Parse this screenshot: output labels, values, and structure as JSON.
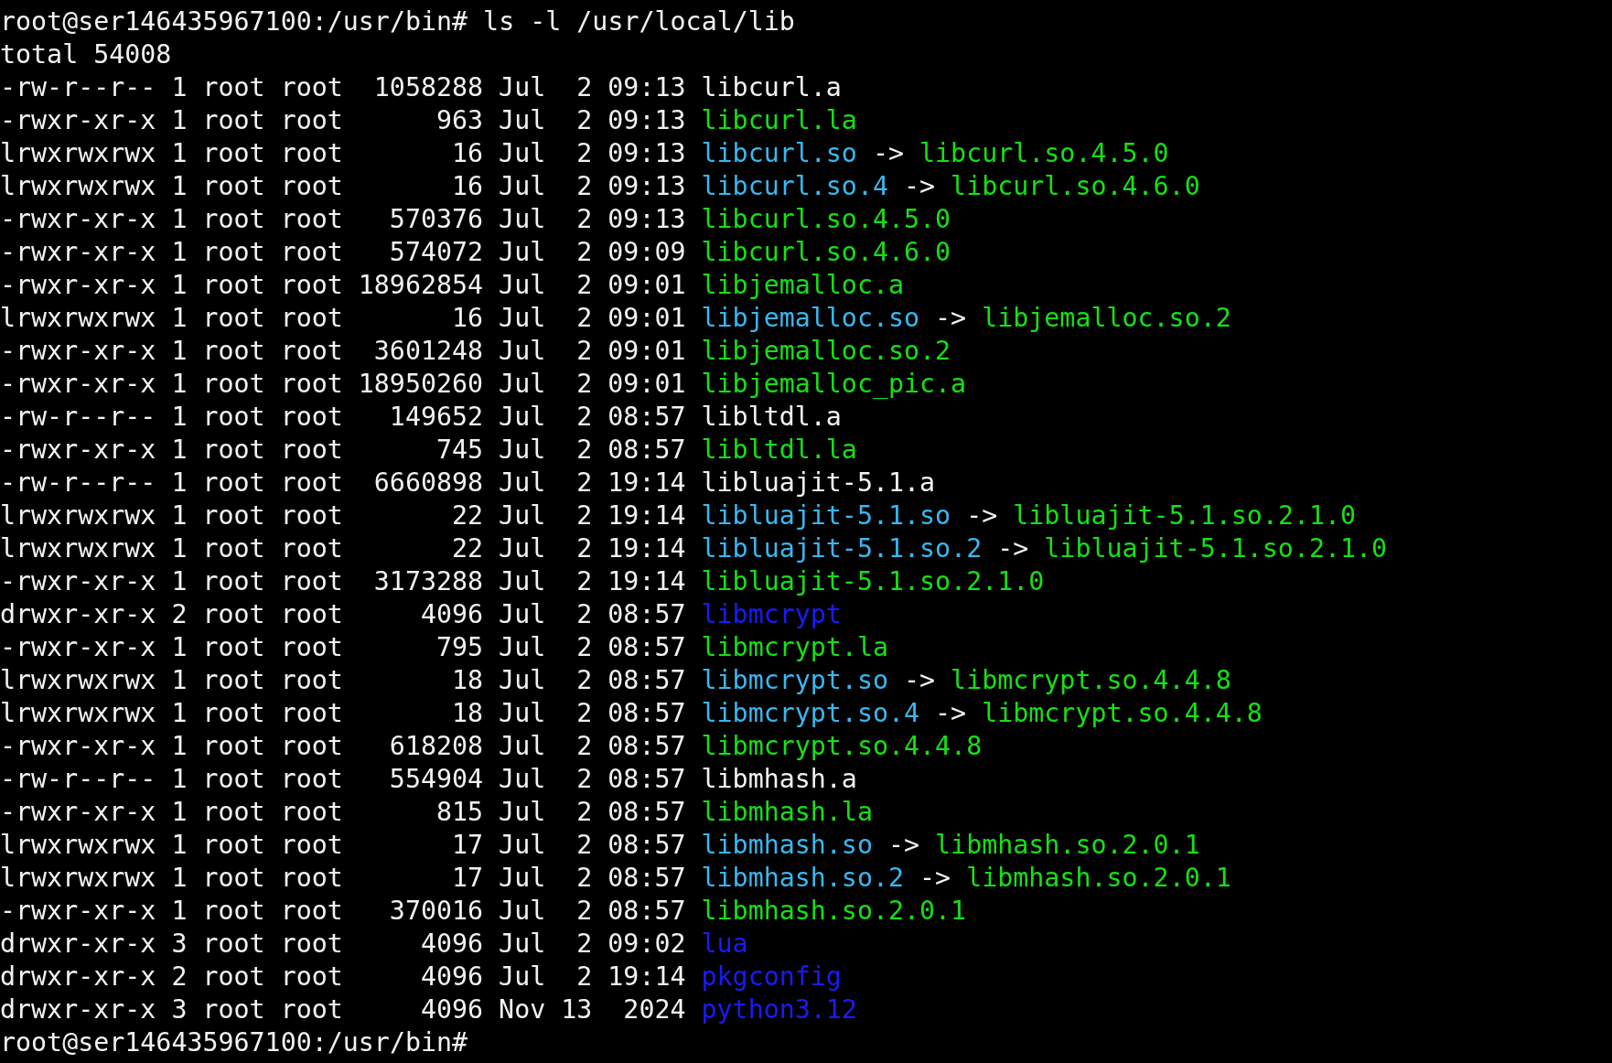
{
  "command_line": "root@ser146435967100:/usr/bin# ls -l /usr/local/lib",
  "total": "total 54008",
  "entries": [
    {
      "mode": "-rw-r--r--",
      "links": "1",
      "owner": "root",
      "group": "root",
      "size": "1058288",
      "month": "Jul",
      "day": "2",
      "time": "09:13",
      "name": "libcurl.a",
      "kind": "plain"
    },
    {
      "mode": "-rwxr-xr-x",
      "links": "1",
      "owner": "root",
      "group": "root",
      "size": "963",
      "month": "Jul",
      "day": "2",
      "time": "09:13",
      "name": "libcurl.la",
      "kind": "exec"
    },
    {
      "mode": "lrwxrwxrwx",
      "links": "1",
      "owner": "root",
      "group": "root",
      "size": "16",
      "month": "Jul",
      "day": "2",
      "time": "09:13",
      "name": "libcurl.so",
      "kind": "link",
      "arrow": "->",
      "target": {
        "name": "libcurl.so.4.5.0",
        "kind": "exec"
      }
    },
    {
      "mode": "lrwxrwxrwx",
      "links": "1",
      "owner": "root",
      "group": "root",
      "size": "16",
      "month": "Jul",
      "day": "2",
      "time": "09:13",
      "name": "libcurl.so.4",
      "kind": "link",
      "arrow": "->",
      "target": {
        "name": "libcurl.so.4.6.0",
        "kind": "exec"
      }
    },
    {
      "mode": "-rwxr-xr-x",
      "links": "1",
      "owner": "root",
      "group": "root",
      "size": "570376",
      "month": "Jul",
      "day": "2",
      "time": "09:13",
      "name": "libcurl.so.4.5.0",
      "kind": "exec"
    },
    {
      "mode": "-rwxr-xr-x",
      "links": "1",
      "owner": "root",
      "group": "root",
      "size": "574072",
      "month": "Jul",
      "day": "2",
      "time": "09:09",
      "name": "libcurl.so.4.6.0",
      "kind": "exec"
    },
    {
      "mode": "-rwxr-xr-x",
      "links": "1",
      "owner": "root",
      "group": "root",
      "size": "18962854",
      "month": "Jul",
      "day": "2",
      "time": "09:01",
      "name": "libjemalloc.a",
      "kind": "exec"
    },
    {
      "mode": "lrwxrwxrwx",
      "links": "1",
      "owner": "root",
      "group": "root",
      "size": "16",
      "month": "Jul",
      "day": "2",
      "time": "09:01",
      "name": "libjemalloc.so",
      "kind": "link",
      "arrow": "->",
      "target": {
        "name": "libjemalloc.so.2",
        "kind": "exec"
      }
    },
    {
      "mode": "-rwxr-xr-x",
      "links": "1",
      "owner": "root",
      "group": "root",
      "size": "3601248",
      "month": "Jul",
      "day": "2",
      "time": "09:01",
      "name": "libjemalloc.so.2",
      "kind": "exec"
    },
    {
      "mode": "-rwxr-xr-x",
      "links": "1",
      "owner": "root",
      "group": "root",
      "size": "18950260",
      "month": "Jul",
      "day": "2",
      "time": "09:01",
      "name": "libjemalloc_pic.a",
      "kind": "exec"
    },
    {
      "mode": "-rw-r--r--",
      "links": "1",
      "owner": "root",
      "group": "root",
      "size": "149652",
      "month": "Jul",
      "day": "2",
      "time": "08:57",
      "name": "libltdl.a",
      "kind": "plain"
    },
    {
      "mode": "-rwxr-xr-x",
      "links": "1",
      "owner": "root",
      "group": "root",
      "size": "745",
      "month": "Jul",
      "day": "2",
      "time": "08:57",
      "name": "libltdl.la",
      "kind": "exec"
    },
    {
      "mode": "-rw-r--r--",
      "links": "1",
      "owner": "root",
      "group": "root",
      "size": "6660898",
      "month": "Jul",
      "day": "2",
      "time": "19:14",
      "name": "libluajit-5.1.a",
      "kind": "plain"
    },
    {
      "mode": "lrwxrwxrwx",
      "links": "1",
      "owner": "root",
      "group": "root",
      "size": "22",
      "month": "Jul",
      "day": "2",
      "time": "19:14",
      "name": "libluajit-5.1.so",
      "kind": "link",
      "arrow": "->",
      "target": {
        "name": "libluajit-5.1.so.2.1.0",
        "kind": "exec"
      }
    },
    {
      "mode": "lrwxrwxrwx",
      "links": "1",
      "owner": "root",
      "group": "root",
      "size": "22",
      "month": "Jul",
      "day": "2",
      "time": "19:14",
      "name": "libluajit-5.1.so.2",
      "kind": "link",
      "arrow": "->",
      "target": {
        "name": "libluajit-5.1.so.2.1.0",
        "kind": "exec"
      }
    },
    {
      "mode": "-rwxr-xr-x",
      "links": "1",
      "owner": "root",
      "group": "root",
      "size": "3173288",
      "month": "Jul",
      "day": "2",
      "time": "19:14",
      "name": "libluajit-5.1.so.2.1.0",
      "kind": "exec"
    },
    {
      "mode": "drwxr-xr-x",
      "links": "2",
      "owner": "root",
      "group": "root",
      "size": "4096",
      "month": "Jul",
      "day": "2",
      "time": "08:57",
      "name": "libmcrypt",
      "kind": "dir"
    },
    {
      "mode": "-rwxr-xr-x",
      "links": "1",
      "owner": "root",
      "group": "root",
      "size": "795",
      "month": "Jul",
      "day": "2",
      "time": "08:57",
      "name": "libmcrypt.la",
      "kind": "exec"
    },
    {
      "mode": "lrwxrwxrwx",
      "links": "1",
      "owner": "root",
      "group": "root",
      "size": "18",
      "month": "Jul",
      "day": "2",
      "time": "08:57",
      "name": "libmcrypt.so",
      "kind": "link",
      "arrow": "->",
      "target": {
        "name": "libmcrypt.so.4.4.8",
        "kind": "exec"
      }
    },
    {
      "mode": "lrwxrwxrwx",
      "links": "1",
      "owner": "root",
      "group": "root",
      "size": "18",
      "month": "Jul",
      "day": "2",
      "time": "08:57",
      "name": "libmcrypt.so.4",
      "kind": "link",
      "arrow": "->",
      "target": {
        "name": "libmcrypt.so.4.4.8",
        "kind": "exec"
      }
    },
    {
      "mode": "-rwxr-xr-x",
      "links": "1",
      "owner": "root",
      "group": "root",
      "size": "618208",
      "month": "Jul",
      "day": "2",
      "time": "08:57",
      "name": "libmcrypt.so.4.4.8",
      "kind": "exec"
    },
    {
      "mode": "-rw-r--r--",
      "links": "1",
      "owner": "root",
      "group": "root",
      "size": "554904",
      "month": "Jul",
      "day": "2",
      "time": "08:57",
      "name": "libmhash.a",
      "kind": "plain"
    },
    {
      "mode": "-rwxr-xr-x",
      "links": "1",
      "owner": "root",
      "group": "root",
      "size": "815",
      "month": "Jul",
      "day": "2",
      "time": "08:57",
      "name": "libmhash.la",
      "kind": "exec"
    },
    {
      "mode": "lrwxrwxrwx",
      "links": "1",
      "owner": "root",
      "group": "root",
      "size": "17",
      "month": "Jul",
      "day": "2",
      "time": "08:57",
      "name": "libmhash.so",
      "kind": "link",
      "arrow": "->",
      "target": {
        "name": "libmhash.so.2.0.1",
        "kind": "exec"
      }
    },
    {
      "mode": "lrwxrwxrwx",
      "links": "1",
      "owner": "root",
      "group": "root",
      "size": "17",
      "month": "Jul",
      "day": "2",
      "time": "08:57",
      "name": "libmhash.so.2",
      "kind": "link",
      "arrow": "->",
      "target": {
        "name": "libmhash.so.2.0.1",
        "kind": "exec"
      }
    },
    {
      "mode": "-rwxr-xr-x",
      "links": "1",
      "owner": "root",
      "group": "root",
      "size": "370016",
      "month": "Jul",
      "day": "2",
      "time": "08:57",
      "name": "libmhash.so.2.0.1",
      "kind": "exec"
    },
    {
      "mode": "drwxr-xr-x",
      "links": "3",
      "owner": "root",
      "group": "root",
      "size": "4096",
      "month": "Jul",
      "day": "2",
      "time": "09:02",
      "name": "lua",
      "kind": "dir"
    },
    {
      "mode": "drwxr-xr-x",
      "links": "2",
      "owner": "root",
      "group": "root",
      "size": "4096",
      "month": "Jul",
      "day": "2",
      "time": "19:14",
      "name": "pkgconfig",
      "kind": "dir"
    },
    {
      "mode": "drwxr-xr-x",
      "links": "3",
      "owner": "root",
      "group": "root",
      "size": "4096",
      "month": "Nov",
      "day": "13",
      "time": "2024",
      "name": "python3.12",
      "kind": "dir"
    }
  ],
  "prompt": "root@ser146435967100:/usr/bin#"
}
